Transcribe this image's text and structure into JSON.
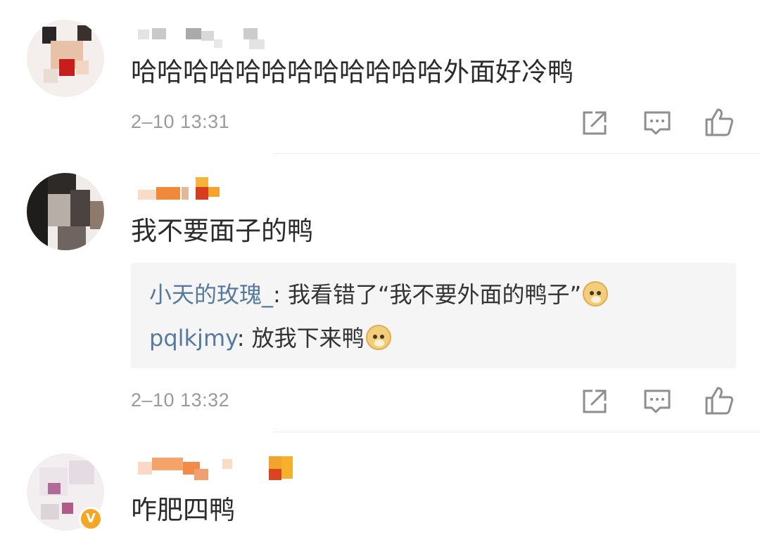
{
  "comments": [
    {
      "text": "哈哈哈哈哈哈哈哈哈哈哈哈外面好冷鸭",
      "time": "2–10 13:31"
    },
    {
      "text": "我不要面子的鸭",
      "replies": [
        {
          "name": "小天的玫瑰_",
          "sep": ": ",
          "text": "我看错了“我不要外面的鸭子”",
          "emoji": "doge-emoji"
        },
        {
          "name": "pqlkjmy",
          "sep": ": ",
          "text": "放我下来鸭",
          "emoji": "doge-emoji"
        }
      ],
      "time": "2–10 13:32"
    },
    {
      "text": "咋肥四鸭",
      "verified_badge": "V"
    }
  ],
  "icons": {
    "share": "share-icon",
    "comment": "comment-icon",
    "like": "like-icon"
  },
  "colors": {
    "reply_name": "#567a9e",
    "timestamp": "#9a9a9a",
    "reply_bg": "#f5f5f5",
    "verified": "#f5a623"
  }
}
